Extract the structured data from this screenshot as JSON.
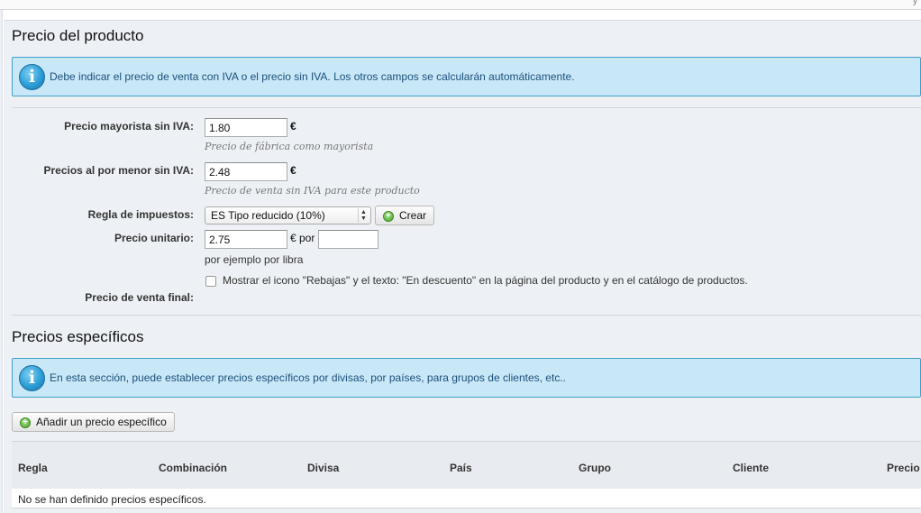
{
  "top_mark": "y",
  "price_section": {
    "title": "Precio del producto",
    "info": "Debe indicar el precio de venta con IVA o el precio sin IVA. Los otros campos se calcularán automáticamente.",
    "wholesale": {
      "label": "Precio mayorista sin IVA:",
      "value": "1.80",
      "unit": "€",
      "hint": "Precio de fábrica como mayorista"
    },
    "retail": {
      "label": "Precios al por menor sin IVA:",
      "value": "2.48",
      "unit": "€",
      "hint": "Precio de venta sin IVA para este producto"
    },
    "tax_rule": {
      "label": "Regla de impuestos:",
      "selected": "ES Tipo reducido (10%)",
      "create_label": "Crear"
    },
    "unit_price": {
      "label": "Precio unitario:",
      "value": "2.75",
      "unit": "€ por",
      "per_value": "",
      "hint": "por ejemplo por libra"
    },
    "on_sale": {
      "label": "Mostrar el icono \"Rebajas\" y el texto: \"En descuento\" en la página del producto y en el catálogo de productos.",
      "checked": false
    },
    "final_price_label": "Precio de venta final:"
  },
  "specific_section": {
    "title": "Precios específicos",
    "info": "En esta sección, puede establecer precios específicos por divisas, por países, para grupos de clientes, etc..",
    "add_button": "Añadir un precio específico",
    "table": {
      "columns": [
        "Regla",
        "Combinación",
        "Divisa",
        "País",
        "Grupo",
        "Cliente",
        "Precio"
      ],
      "empty_message": "No se han definido precios específicos."
    }
  }
}
